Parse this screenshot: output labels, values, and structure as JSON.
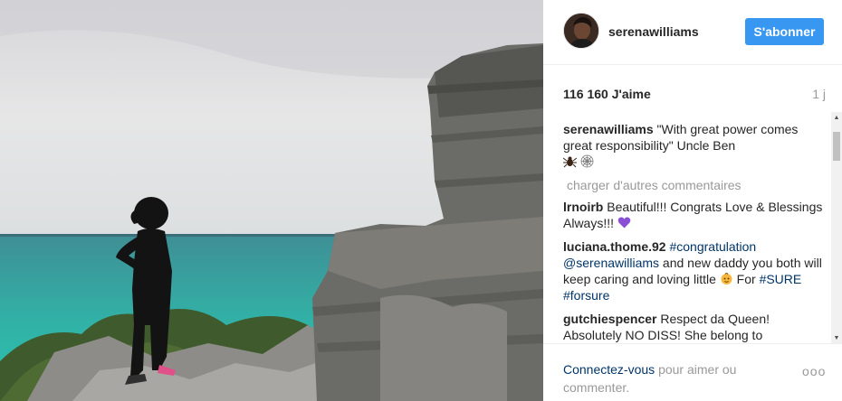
{
  "post": {
    "username": "serenawilliams",
    "follow_label": "S'abonner",
    "likes": "116 160 J'aime",
    "time_ago": "1 j",
    "caption": {
      "user": "serenawilliams",
      "text": "\"With great power comes great responsibility\" Uncle Ben"
    },
    "load_more_label": "charger d'autres commentaires",
    "comments": [
      {
        "user": "lrnoirb",
        "text": "Beautiful!!! Congrats Love & Blessings Always!!!"
      },
      {
        "user": "luciana.thome.92",
        "tag1": "#congratulation",
        "mention": "@serenawilliams",
        "text1": "and new daddy you both will keep caring and loving little",
        "text2": "For",
        "tag2": "#SURE",
        "tag3": "#forsure"
      },
      {
        "user": "gutchiespencer",
        "text": "Respect da Queen! Absolutely NO DISS! She belong to"
      }
    ],
    "footer": {
      "login_link": "Connectez-vous",
      "login_text": "pour aimer ou commenter.",
      "more_label": "ooo"
    }
  },
  "icons": {
    "caption_emoji_1": "spider-emoji",
    "caption_emoji_2": "spiderweb-emoji",
    "heart_emoji": "purple-heart-emoji",
    "baby_emoji": "baby-emoji"
  },
  "colors": {
    "follow_button": "#3897f0",
    "link": "#003569",
    "muted": "#999999"
  }
}
